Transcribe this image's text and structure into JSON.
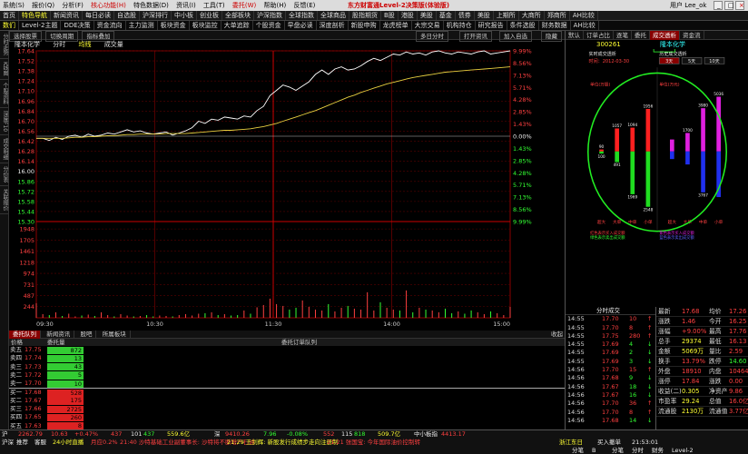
{
  "app": {
    "title": "东方财富通Level-2决策版(体验版)",
    "menu": [
      "系统(S)",
      "报价(Q)",
      "分析(F)",
      "核心功能(H)",
      "特色数据(D)",
      "资讯(I)",
      "工具(T)",
      "委托(W)",
      "帮助(H)",
      "反馈(E)"
    ],
    "user": "用户 Lee_ok"
  },
  "nav1": [
    "首页",
    "特色导航",
    "新闻资讯",
    "每日必读",
    "自选股",
    "沪深排行",
    "中小板",
    "创业板",
    "全部板块",
    "沪深指数",
    "全球指数",
    "全球商品",
    "股指期货",
    "B股",
    "港股",
    "美股",
    "基金",
    "债券",
    "美股",
    "上期所",
    "大商所",
    "郑商所",
    "AH比较"
  ],
  "nav2": [
    "数们",
    "Level-2主题",
    "DDE决策",
    "资金流向",
    "主力监测",
    "板块资金",
    "板块监控",
    "大单追踪",
    "个股资金",
    "早盘必读",
    "深度剖析",
    "新股申购",
    "龙虎榜单",
    "大宗交易",
    "机构持仓",
    "研究报告",
    "条件选股",
    "财务数据",
    "AH比较"
  ],
  "left_sidebar": [
    "分时走势",
    "K线图",
    "个股资料",
    "深度F10",
    "成交明细",
    "分价表",
    "关联报价"
  ],
  "toolbar": {
    "items": [
      "选择股票",
      "切换周期",
      "指标叠加"
    ],
    "right_items": [
      "多日分时",
      "打开资讯",
      "加入自选",
      "隐藏"
    ]
  },
  "chart_tabs": {
    "stock_name": "隆本化学",
    "items": [
      "分时",
      "均线",
      "成交量"
    ],
    "active": 1
  },
  "chart_data": {
    "type": "line",
    "time_labels": [
      "09:30",
      "10:30",
      "11:30",
      "14:00",
      "15:00"
    ],
    "price_axis": [
      "17.64",
      "17.52",
      "17.38",
      "17.24",
      "17.10",
      "16.96",
      "16.84",
      "16.70",
      "16.56",
      "16.42",
      "16.28",
      "16.14",
      "16.00",
      "15.86",
      "15.72",
      "15.58",
      "15.44",
      "15.30"
    ],
    "pct_axis": [
      "9.99%",
      "8.56%",
      "7.13%",
      "5.71%",
      "4.28%",
      "2.85%",
      "1.43%",
      "0.00%",
      "1.43%",
      "2.85%",
      "4.28%",
      "5.71%",
      "7.13%",
      "8.56%",
      "9.99%"
    ],
    "pct_colors": [
      "red",
      "red",
      "red",
      "red",
      "red",
      "red",
      "red",
      "wht",
      "green",
      "green",
      "green",
      "green",
      "green",
      "green",
      "green"
    ],
    "prev_close": 16.04,
    "ylim": [
      14.44,
      17.64
    ],
    "price": [
      16.0,
      16.0,
      15.96,
      16.02,
      15.98,
      16.04,
      16.06,
      16.02,
      16.08,
      16.04,
      16.06,
      16.1,
      16.08,
      16.12,
      16.16,
      16.12,
      16.14,
      16.1,
      16.08,
      16.1,
      16.12,
      16.06,
      16.1,
      16.14,
      16.2,
      16.32,
      16.28,
      16.36,
      16.34,
      16.4,
      16.38,
      16.36,
      16.42,
      16.4,
      16.52,
      16.6,
      16.8,
      16.9,
      17.0,
      16.96,
      16.9,
      16.98,
      17.06,
      17.2,
      17.28,
      17.2,
      17.3,
      17.34,
      17.28,
      17.3,
      17.36,
      17.44,
      17.5,
      17.46,
      17.52,
      17.58,
      17.56,
      17.62,
      17.58,
      17.6,
      17.56,
      17.62,
      17.64,
      17.6,
      17.58,
      17.62,
      17.6,
      17.58,
      17.62,
      17.64,
      17.58,
      17.6,
      17.62,
      17.64
    ],
    "avg": [
      16.0,
      16.0,
      16.0,
      16.0,
      16.0,
      16.01,
      16.02,
      16.02,
      16.03,
      16.03,
      16.04,
      16.05,
      16.05,
      16.06,
      16.07,
      16.07,
      16.08,
      16.08,
      16.08,
      16.08,
      16.09,
      16.09,
      16.09,
      16.09,
      16.1,
      16.11,
      16.12,
      16.13,
      16.14,
      16.15,
      16.15,
      16.16,
      16.17,
      16.18,
      16.2,
      16.22,
      16.25,
      16.28,
      16.32,
      16.36,
      16.4,
      16.44,
      16.48,
      16.52,
      16.57,
      16.62,
      16.67,
      16.72,
      16.77,
      16.81,
      16.86,
      16.9,
      16.94,
      16.98,
      17.02,
      17.05,
      17.08,
      17.11,
      17.14,
      17.16,
      17.18,
      17.2,
      17.22,
      17.24,
      17.25,
      17.26,
      17.27,
      17.28,
      17.29,
      17.3,
      17.31,
      17.32,
      17.33,
      17.34
    ],
    "volume_axis": [
      "1948",
      "1705",
      "1461",
      "1218",
      "974",
      "731",
      "487",
      "244"
    ],
    "volume_ylim": [
      0,
      2070
    ],
    "volume": [
      320,
      80,
      60,
      120,
      40,
      90,
      30,
      50,
      70,
      40,
      120,
      60,
      30,
      80,
      50,
      30,
      40,
      60,
      30,
      50,
      40,
      30,
      60,
      80,
      50,
      90,
      100,
      120,
      60,
      80,
      50,
      60,
      160,
      90,
      230,
      280,
      420,
      300,
      260,
      180,
      220,
      380,
      240,
      180,
      160,
      300,
      140,
      220,
      260,
      200,
      180,
      560,
      160,
      340,
      220,
      180,
      160,
      600,
      120,
      220,
      180,
      160,
      120,
      200,
      100,
      140,
      90,
      160,
      120,
      80,
      140,
      100,
      60,
      240
    ]
  },
  "order_book": {
    "tabs": [
      "委托队列",
      "新闻资讯",
      "股吧",
      "所属板块"
    ],
    "head": [
      "价格",
      "委托量",
      "委托订单队列"
    ],
    "sell": [
      {
        "label": "卖五",
        "price": "17.75",
        "qty": "872"
      },
      {
        "label": "卖四",
        "price": "17.74",
        "qty": "13"
      },
      {
        "label": "卖三",
        "price": "17.73",
        "qty": "43"
      },
      {
        "label": "卖二",
        "price": "17.72",
        "qty": "5"
      },
      {
        "label": "卖一",
        "price": "17.70",
        "qty": "10"
      }
    ],
    "buy": [
      {
        "label": "买一",
        "price": "17.68",
        "qty": "528"
      },
      {
        "label": "买二",
        "price": "17.67",
        "qty": "175"
      },
      {
        "label": "买三",
        "price": "17.66",
        "qty": "2725"
      },
      {
        "label": "买四",
        "price": "17.65",
        "qty": "260"
      },
      {
        "label": "买五",
        "price": "17.63",
        "qty": "8"
      }
    ]
  },
  "right_panel": {
    "tabs": [
      "默认",
      "订单占比",
      "逐笔",
      "委托",
      "成交透析",
      "资金流"
    ],
    "active_tab": 4,
    "code": "300261",
    "name": "隆本化学",
    "realtime_title": "实时成交透析",
    "history_title": "历史成交透析",
    "time_label": "时间：2012-03-30",
    "day_buttons": [
      "3天",
      "5天",
      "10天"
    ],
    "left_unit": "单位(万股)",
    "right_unit": "单位(万元)",
    "left_bars_labels": [
      "超大",
      "大单",
      "中单",
      "小单"
    ],
    "right_bars_labels": [
      "超大",
      "大单",
      "中单",
      "小单"
    ],
    "left_values": {
      "buy": [
        "90",
        "1057",
        "1094",
        "1956"
      ],
      "sell": [
        "100",
        "491",
        "1969",
        "2548"
      ]
    },
    "right_values": {
      "buy": [
        "",
        "1700",
        "3980",
        "5036"
      ],
      "sell": [
        "",
        "",
        "3767",
        ""
      ]
    },
    "legend": [
      "红色表示买入成交额",
      "绿色表示卖出成交额",
      "紫色表示买入成交额",
      "蓝色表示卖出成交额"
    ],
    "ticks_title": "分时成交",
    "ticks": [
      {
        "t": "14:55",
        "p": "17.70",
        "v": "10",
        "c": "red"
      },
      {
        "t": "14:55",
        "p": "17.70",
        "v": "8",
        "c": "red"
      },
      {
        "t": "14:55",
        "p": "17.75",
        "v": "280",
        "c": "red"
      },
      {
        "t": "14:55",
        "p": "17.69",
        "v": "4",
        "c": "green"
      },
      {
        "t": "14:55",
        "p": "17.69",
        "v": "2",
        "c": "green"
      },
      {
        "t": "14:55",
        "p": "17.69",
        "v": "3",
        "c": "green"
      },
      {
        "t": "14:56",
        "p": "17.70",
        "v": "15",
        "c": "red"
      },
      {
        "t": "14:56",
        "p": "17.68",
        "v": "9",
        "c": "green"
      },
      {
        "t": "14:56",
        "p": "17.67",
        "v": "18",
        "c": "green"
      },
      {
        "t": "14:56",
        "p": "17.67",
        "v": "16",
        "c": "green"
      },
      {
        "t": "14:56",
        "p": "17.70",
        "v": "36",
        "c": "red"
      },
      {
        "t": "14:56",
        "p": "17.70",
        "v": "8",
        "c": "red"
      },
      {
        "t": "14:56",
        "p": "17.68",
        "v": "14",
        "c": "green"
      },
      {
        "t": "14:57",
        "p": "17.69",
        "v": "8",
        "c": "red"
      },
      {
        "t": "14:57",
        "p": "17.70",
        "v": "3",
        "c": "red"
      },
      {
        "t": "14:57",
        "p": "17.68",
        "v": "24",
        "c": "green"
      },
      {
        "t": "14:59",
        "p": "17.68",
        "v": "328",
        "c": "green"
      }
    ],
    "quote": [
      {
        "k": "最新",
        "v": "17.68",
        "k2": "均价",
        "v2": "17.26"
      },
      {
        "k": "涨跌",
        "v": "1.46",
        "k2": "今开",
        "v2": "16.25"
      },
      {
        "k": "涨幅",
        "v": "+9.00%",
        "k2": "最高",
        "v2": "17.76"
      },
      {
        "k": "总手",
        "v": "29374",
        "k2": "最低",
        "v2": "16.13"
      },
      {
        "k": "金额",
        "v": "5069万",
        "k2": "量比",
        "v2": "2.59"
      },
      {
        "k": "换手",
        "v": "13.79%",
        "k2": "跌停",
        "v2": "14.60"
      },
      {
        "k": "外盘",
        "v": "18910",
        "k2": "内盘",
        "v2": "10464"
      },
      {
        "k": "涨停",
        "v": "17.84",
        "k2": "涨跌",
        "v2": "0.00"
      },
      {
        "k": "收益(二)",
        "v": "0.305",
        "k2": "净资产",
        "v2": "9.86"
      },
      {
        "k": "市盈率",
        "v": "29.24",
        "k2": "总值",
        "v2": "16.0亿"
      },
      {
        "k": "流通股",
        "v": "2130万",
        "k2": "流通值",
        "v2": "3.77亿"
      }
    ]
  },
  "status": {
    "row1": [
      {
        "t": "沪",
        "c": "wht"
      },
      {
        "t": "2262.79",
        "c": "red"
      },
      {
        "t": "10.63",
        "c": "red"
      },
      {
        "t": "+0.47%",
        "c": "red"
      },
      {
        "t": "437",
        "c": "red"
      },
      {
        "t": "101",
        "c": "wht"
      },
      {
        "t": "437",
        "c": "green"
      },
      {
        "t": "559.6亿",
        "c": "yel"
      },
      {
        "t": "深",
        "c": "wht"
      },
      {
        "t": "9410.26",
        "c": "red"
      },
      {
        "t": "7.96",
        "c": "green"
      },
      {
        "t": "-0.08%",
        "c": "green"
      },
      {
        "t": "552",
        "c": "red"
      },
      {
        "t": "115",
        "c": "wht"
      },
      {
        "t": "818",
        "c": "green"
      },
      {
        "t": "509.7亿",
        "c": "yel"
      },
      {
        "t": "中小板指",
        "c": "wht"
      },
      {
        "t": "4413.17",
        "c": "red"
      }
    ],
    "row2": [
      {
        "t": "沪深",
        "c": "wht"
      },
      {
        "t": "推荐",
        "c": "wht"
      },
      {
        "t": "客服",
        "c": "wht"
      },
      {
        "t": "24小时直播",
        "c": "yel"
      },
      {
        "t": "月应0.2%",
        "c": "red"
      },
      {
        "t": "21:40 沙特基础工业副董事长: 沙特将不断增产石油",
        "c": "red"
      },
      {
        "t": "21:29 王剑辉: 新股发行成绩步走向注册制",
        "c": "yel"
      },
      {
        "t": "21:21 张国宝: 今年国际油价控制转",
        "c": "red"
      },
      {
        "t": "浙江东日",
        "c": "yel"
      },
      {
        "t": "买入撤单",
        "c": "wht"
      },
      {
        "t": "21:53:01",
        "c": "wht"
      }
    ],
    "row3": [
      {
        "t": "分笔",
        "c": "wht"
      },
      {
        "t": "B",
        "c": "wht"
      },
      {
        "t": "分笔",
        "c": "wht"
      },
      {
        "t": "分时",
        "c": "wht"
      },
      {
        "t": "财务",
        "c": "wht"
      },
      {
        "t": "Level-2",
        "c": "wht"
      }
    ]
  }
}
